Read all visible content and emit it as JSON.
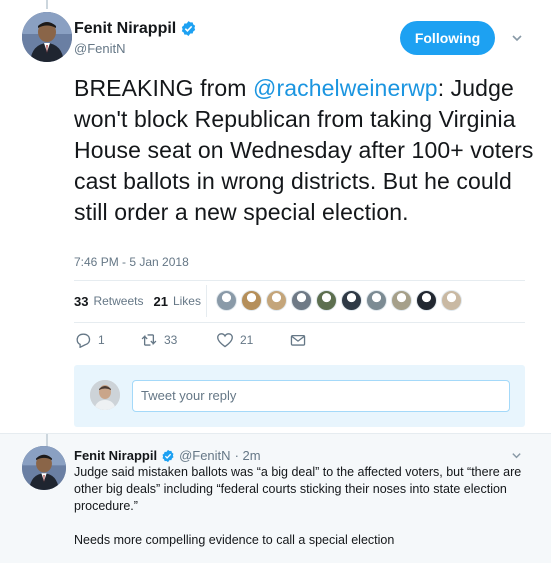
{
  "tweet": {
    "author": {
      "display_name": "Fenit Nirappil",
      "screen_name": "@FenitN",
      "avatar": "author-avatar"
    },
    "follow_label": "Following",
    "text_prefix": "BREAKING from ",
    "mention": "@rachelweinerwp",
    "text_suffix": ": Judge won't block Republican from taking Virginia House seat on Wednesday after 100+ voters cast ballots in wrong districts. But he could still order a new special election.",
    "timestamp": "7:46 PM - 5 Jan 2018",
    "stats": {
      "retweets_count": "33",
      "retweets_label": "Retweets",
      "likes_count": "21",
      "likes_label": "Likes"
    },
    "likers": [
      "#8a9aa8",
      "#b58f5a",
      "#c4a57a",
      "#6f7a86",
      "#5d6f4f",
      "#2f3a46",
      "#7c8b93",
      "#a6a08a",
      "#222831",
      "#c9b9a3"
    ],
    "actions": {
      "reply_count": "1",
      "retweet_count": "33",
      "like_count": "21"
    }
  },
  "reply_box": {
    "placeholder": "Tweet your reply"
  },
  "reply": {
    "display_name": "Fenit Nirappil",
    "screen_name": "@FenitN",
    "time": "· 2m",
    "paragraph1": "Judge said mistaken ballots was “a big deal” to the affected voters, but “there are other big deals” including “federal courts sticking their noses into state election procedure.”",
    "paragraph2": "Needs more compelling evidence to call a special election"
  },
  "colors": {
    "accent": "#1da1f2",
    "link": "#1b95e0",
    "muted": "#657786",
    "reply_bg": "#e8f5fd",
    "thread_bg": "#f5f8fa"
  }
}
